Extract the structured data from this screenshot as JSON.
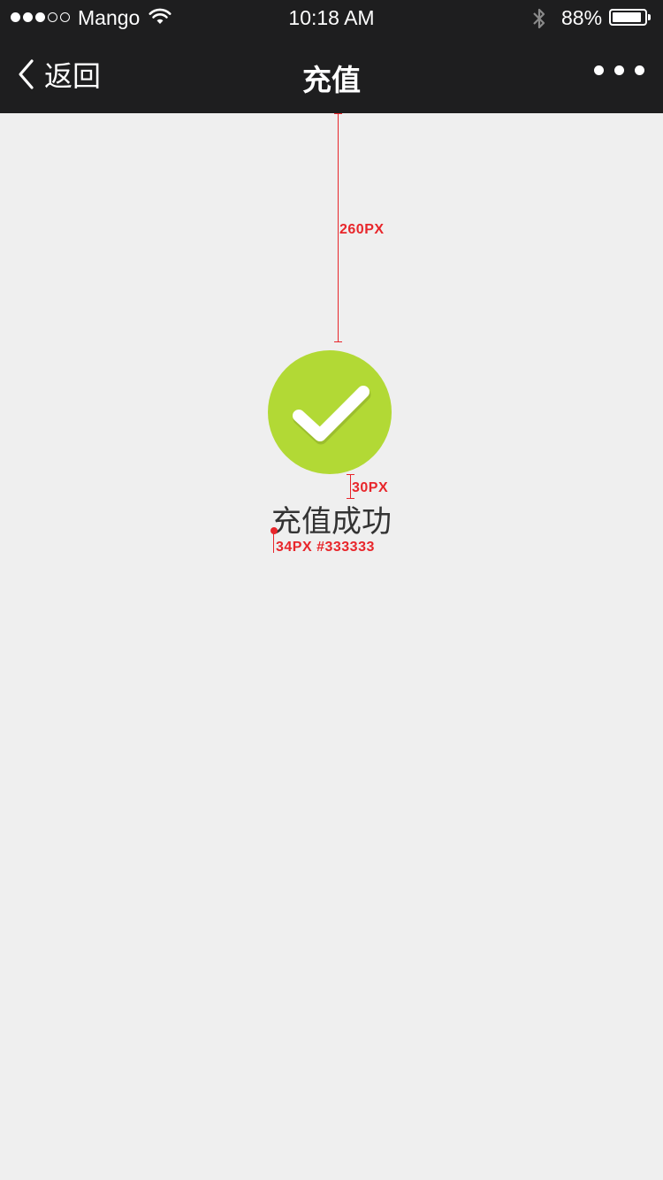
{
  "status_bar": {
    "signal_full": 3,
    "signal_empty": 2,
    "carrier": "Mango",
    "time": "10:18 AM",
    "battery_percent": "88%",
    "battery_level": 0.88,
    "icons": [
      "wifi-icon",
      "bluetooth-icon",
      "battery-icon"
    ]
  },
  "nav": {
    "back_label": "返回",
    "title": "充值",
    "more_icon": "more-dots-icon"
  },
  "result": {
    "message": "充值成功",
    "icon": "check-circle-icon",
    "accent_color": "#b2d935",
    "text_color": "#333333"
  },
  "annotations": {
    "top_gap": "260PX",
    "icon_gap": "30PX",
    "text_spec": "34PX #333333",
    "color": "#e8262b"
  }
}
